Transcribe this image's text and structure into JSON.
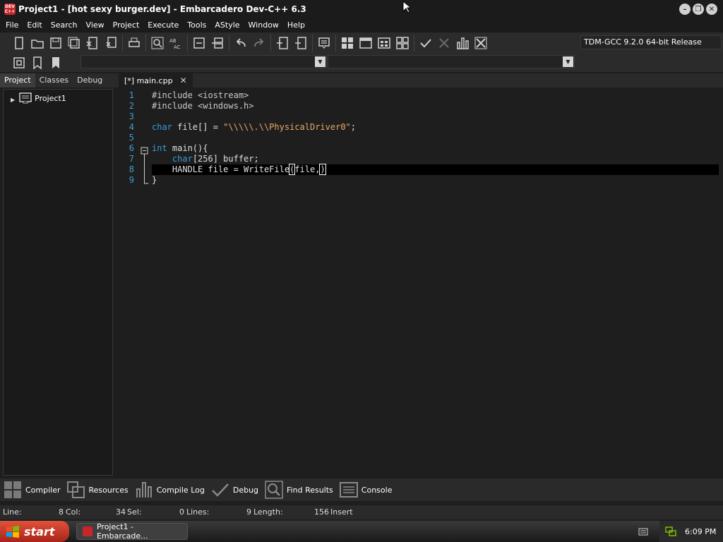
{
  "window": {
    "title": "Project1 - [hot sexy burger.dev] - Embarcadero Dev-C++ 6.3",
    "app_icon_text": "DEV C++"
  },
  "menu": [
    "File",
    "Edit",
    "Search",
    "View",
    "Project",
    "Execute",
    "Tools",
    "AStyle",
    "Window",
    "Help"
  ],
  "toolbar": {
    "compiler": "TDM-GCC 9.2.0 64-bit Release"
  },
  "left_tabs": [
    "Project",
    "Classes",
    "Debug"
  ],
  "project_tree": {
    "root": "Project1"
  },
  "editor": {
    "tab_label": "[*] main.cpp",
    "line_numbers": [
      "1",
      "2",
      "3",
      "4",
      "5",
      "6",
      "7",
      "8",
      "9"
    ],
    "lines": [
      {
        "segments": [
          {
            "text": "#include <iostream>",
            "cls": "pp"
          }
        ]
      },
      {
        "segments": [
          {
            "text": "#include <windows.h>",
            "cls": "pp"
          }
        ]
      },
      {
        "segments": []
      },
      {
        "segments": [
          {
            "text": "char",
            "cls": "kw"
          },
          {
            "text": " file[] = "
          },
          {
            "text": "\"\\\\\\\\\\.\\\\PhysicalDriver0\"",
            "cls": "str"
          },
          {
            "text": ";"
          }
        ]
      },
      {
        "segments": []
      },
      {
        "segments": [
          {
            "text": "int",
            "cls": "kw"
          },
          {
            "text": " main(){"
          }
        ]
      },
      {
        "segments": [
          {
            "text": "    "
          },
          {
            "text": "char",
            "cls": "kw"
          },
          {
            "text": "[256] buffer;"
          }
        ]
      },
      {
        "segments": [
          {
            "text": "    HANDLE file = WriteFile"
          },
          {
            "text": "(",
            "cls": "cursor-box"
          },
          {
            "text": "file,"
          },
          {
            "text": ")",
            "cls": "cursor-box"
          }
        ]
      },
      {
        "segments": [
          {
            "text": "}"
          }
        ]
      }
    ],
    "active_line": 7
  },
  "bottom_tabs": [
    "Compiler",
    "Resources",
    "Compile Log",
    "Debug",
    "Find Results",
    "Console"
  ],
  "status": {
    "line_label": "Line:",
    "line_value": "8",
    "col_label": "Col:",
    "col_value": "34",
    "sel_label": "Sel:",
    "sel_value": "0",
    "lines_label": "Lines:",
    "lines_value": "9",
    "length_label": "Length:",
    "length_value": "156",
    "mode": "Insert"
  },
  "taskbar": {
    "start": "start",
    "window_label": "Project1 - Embarcade...",
    "clock": "6:09 PM"
  }
}
